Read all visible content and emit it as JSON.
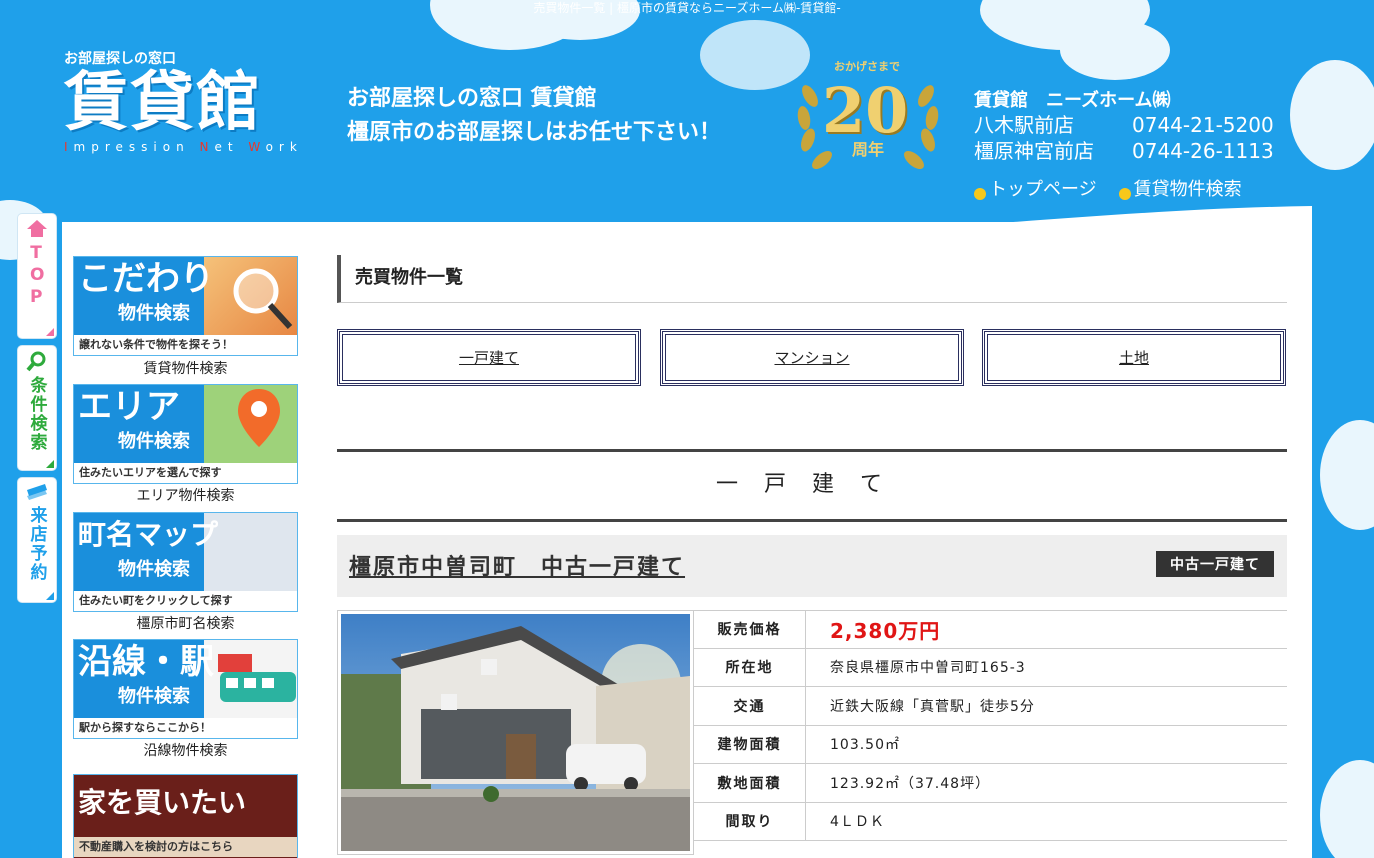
{
  "window_title": "売買物件一覧 | 橿原市の賃貸ならニーズホーム㈱-賃貸館-",
  "logo": {
    "small": "お部屋探しの窓口",
    "big": "賃貸館",
    "sub_pre": "I",
    "sub_1": "mpression ",
    "sub_n": "N",
    "sub_2": "et ",
    "sub_w": "W",
    "sub_3": "ork"
  },
  "catch": {
    "line1": "お部屋探しの窓口 賃貸館",
    "line2": "橿原市のお部屋探しはお任せ下さい！"
  },
  "anniversary": {
    "top": "おかげさまで",
    "number": "20",
    "label": "周年"
  },
  "company": {
    "name": "賃貸館　ニーズホーム㈱",
    "stores": [
      {
        "store": "八木駅前店",
        "tel": "0744-21-5200"
      },
      {
        "store": "橿原神宮前店",
        "tel": "0744-26-1113"
      }
    ]
  },
  "nav": {
    "top": "トップページ",
    "search": "賃貸物件検索"
  },
  "sidetabs": {
    "top": "TOP",
    "condition": "条件検索",
    "visit": "来店予約"
  },
  "banners": [
    {
      "t1": "こだわり",
      "t2": "物件検索",
      "t3": "譲れない条件で物件を探そう！",
      "caption": "賃貸物件検索"
    },
    {
      "t1": "エリア",
      "t2": "物件検索",
      "t3": "住みたいエリアを選んで探す",
      "caption": "エリア物件検索"
    },
    {
      "t1": "町名マップ",
      "t2": "物件検索",
      "t3": "住みたい町をクリックして探す",
      "caption": "橿原市町名検索"
    },
    {
      "t1": "沿線・駅",
      "t2": "物件検索",
      "t3": "駅から探すならここから！",
      "caption": "沿線物件検索"
    },
    {
      "t1": "家を買いたい",
      "t2": "",
      "t3": "不動産購入を検討の方はこちら",
      "caption": ""
    }
  ],
  "page_heading": "売買物件一覧",
  "categories": [
    "一戸建て",
    "マンション",
    "土地"
  ],
  "section_heading": "一戸建て",
  "property": {
    "title": "橿原市中曽司町　中古一戸建て",
    "badge": "中古一戸建て",
    "specs": [
      {
        "key": "販売価格",
        "value": "2,380万円"
      },
      {
        "key": "所在地",
        "value": "奈良県橿原市中曽司町165-3"
      },
      {
        "key": "交通",
        "value": "近鉄大阪線「真菅駅」徒歩5分"
      },
      {
        "key": "建物面積",
        "value": "103.50㎡"
      },
      {
        "key": "敷地面積",
        "value": "123.92㎡（37.48坪）"
      },
      {
        "key": "間取り",
        "value": "4ＬＤＫ"
      }
    ]
  },
  "colors": {
    "sky": "#1fa0ea",
    "price": "#e01515",
    "badge": "#333333",
    "nav_dot": "#f7c81b"
  }
}
